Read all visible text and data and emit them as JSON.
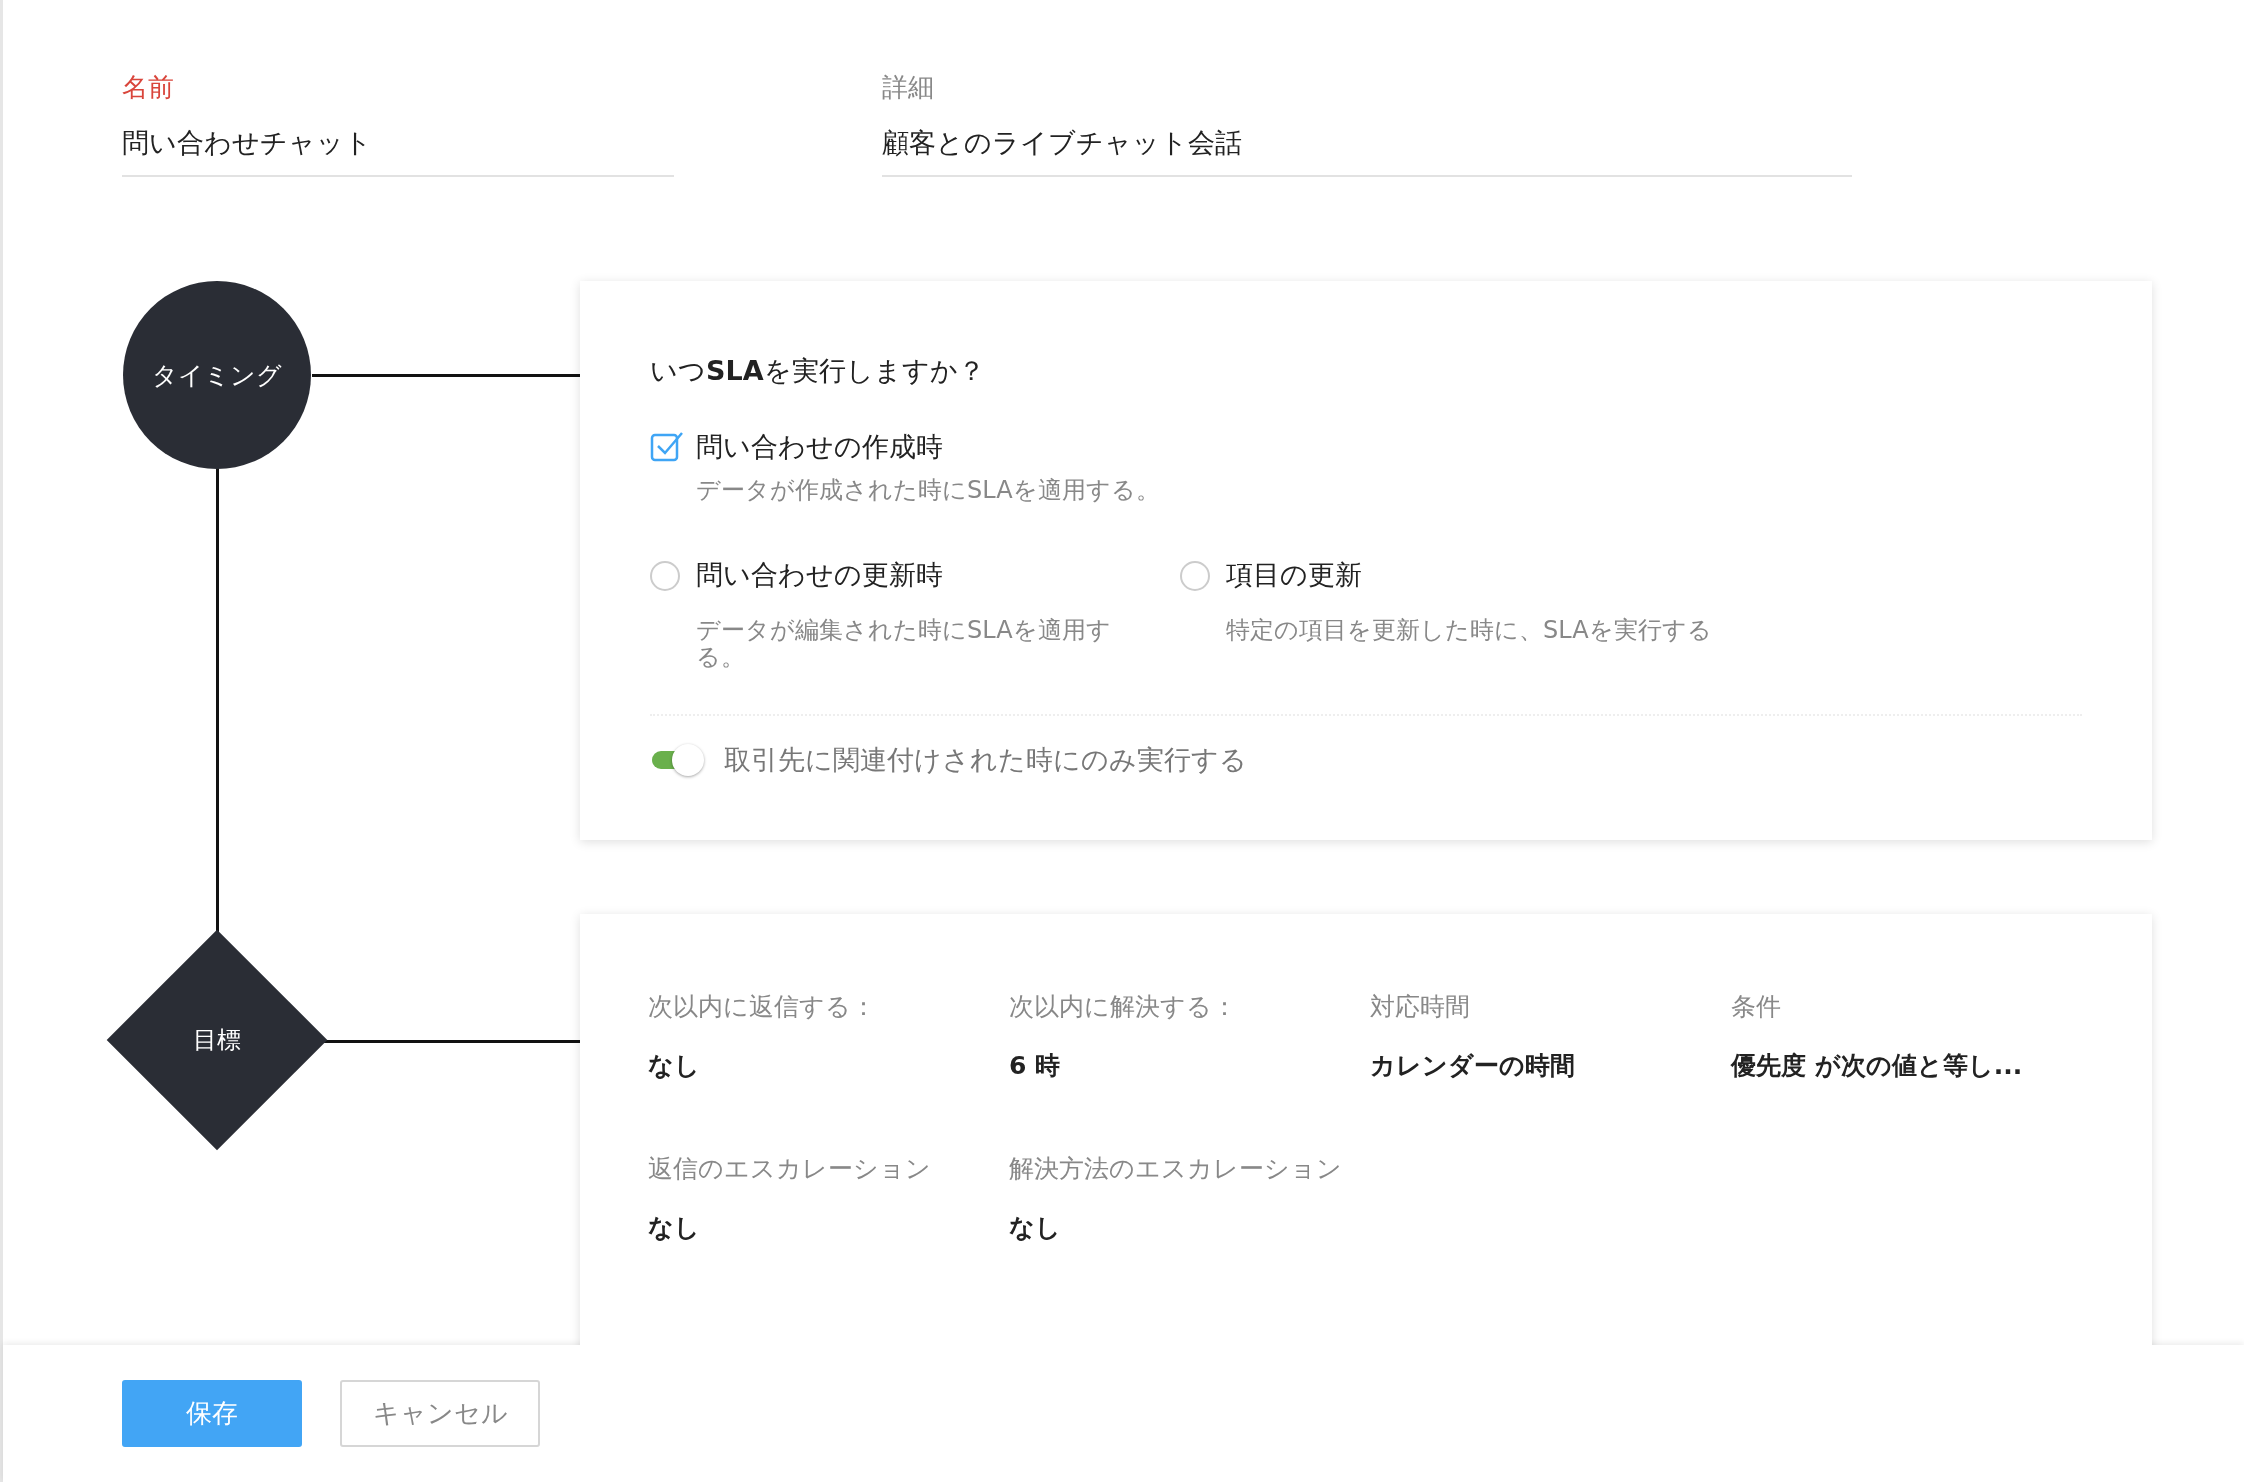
{
  "form": {
    "fields": [
      {
        "label": "名前",
        "value": "問い合わせチャット",
        "required": true
      },
      {
        "label": "詳細",
        "value": "顧客とのライブチャット会話",
        "required": false
      }
    ]
  },
  "timing": {
    "node": "タイミング",
    "question": "いつ**SLA**を実行しますか？",
    "options": [
      {
        "kind": "checkbox",
        "label": "問い合わせの作成時",
        "description": "データが作成された時にSLAを適用する。",
        "checked": true
      },
      {
        "kind": "radio",
        "label": "問い合わせの更新時",
        "description": "データが編集された時にSLAを適用する。",
        "selected": false
      },
      {
        "kind": "radio",
        "label": "項目の更新",
        "description": "特定の項目を更新した時に、SLAを実行する",
        "selected": false
      }
    ],
    "toggle": {
      "label": "取引先に関連付けされた時にのみ実行する",
      "on": true
    }
  },
  "goals": {
    "node": "目標",
    "items": [
      {
        "label": "次以内に返信する：",
        "value": "なし"
      },
      {
        "label": "次以内に解決する：",
        "value": "6 時"
      },
      {
        "label": "対応時間",
        "value": "カレンダーの時間"
      },
      {
        "label": "条件",
        "value": "優先度 が次の値と等し..."
      },
      {
        "label": "返信のエスカレーション",
        "value": "なし"
      },
      {
        "label": "解決方法のエスカレーション",
        "value": "なし"
      }
    ]
  },
  "footer": {
    "buttons": [
      {
        "label": "保存",
        "kind": "primary"
      },
      {
        "label": "キャンセル",
        "kind": "secondary"
      }
    ]
  }
}
